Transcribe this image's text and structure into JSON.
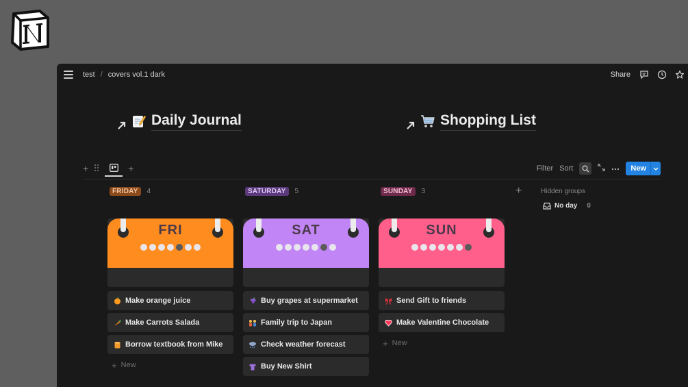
{
  "breadcrumb": {
    "root": "test",
    "separator": "/",
    "page": "covers vol.1 dark"
  },
  "topbar": {
    "share_label": "Share",
    "icons": [
      "comment-icon",
      "clock-icon",
      "star-icon"
    ]
  },
  "headings": [
    {
      "title": "Daily Journal",
      "emoji": "memo-icon"
    },
    {
      "title": "Shopping List",
      "emoji": "cart-icon"
    }
  ],
  "toolbar": {
    "filter_label": "Filter",
    "sort_label": "Sort",
    "new_label": "New"
  },
  "columns": [
    {
      "label": "FRIDAY",
      "count": "4",
      "badge_bg": "#8a4a1c",
      "badge_fg": "#f4c6a2",
      "cover": {
        "day": "FRI",
        "color": "#ff8c1f"
      },
      "items": [
        {
          "label": "Make orange juice",
          "icon": "orange-icon"
        },
        {
          "label": "Make Carrots Salada",
          "icon": "carrot-icon"
        },
        {
          "label": "Borrow textbook from Mike",
          "icon": "book-icon"
        }
      ],
      "new_label": "New"
    },
    {
      "label": "SATURDAY",
      "count": "5",
      "badge_bg": "#5a3a7a",
      "badge_fg": "#e1c9f7",
      "cover": {
        "day": "SAT",
        "color": "#c285f5"
      },
      "items": [
        {
          "label": "Buy grapes at supermarket",
          "icon": "grapes-icon"
        },
        {
          "label": "Family trip to Japan",
          "icon": "family-icon"
        },
        {
          "label": "Check weather forecast",
          "icon": "rain-cloud-icon"
        },
        {
          "label": "Buy New Shirt",
          "icon": "shirt-icon"
        }
      ]
    },
    {
      "label": "SUNDAY",
      "count": "3",
      "badge_bg": "#6e2a4a",
      "badge_fg": "#f7c3d8",
      "cover": {
        "day": "SUN",
        "color": "#ff5f8a"
      },
      "items": [
        {
          "label": "Send Gift to friends",
          "icon": "ribbon-icon"
        },
        {
          "label": "Make Valentine Chocolate",
          "icon": "heart-icon"
        }
      ],
      "new_label": "New"
    }
  ],
  "hidden_groups": {
    "title": "Hidden groups",
    "item_label": "No day",
    "item_count": "0"
  }
}
